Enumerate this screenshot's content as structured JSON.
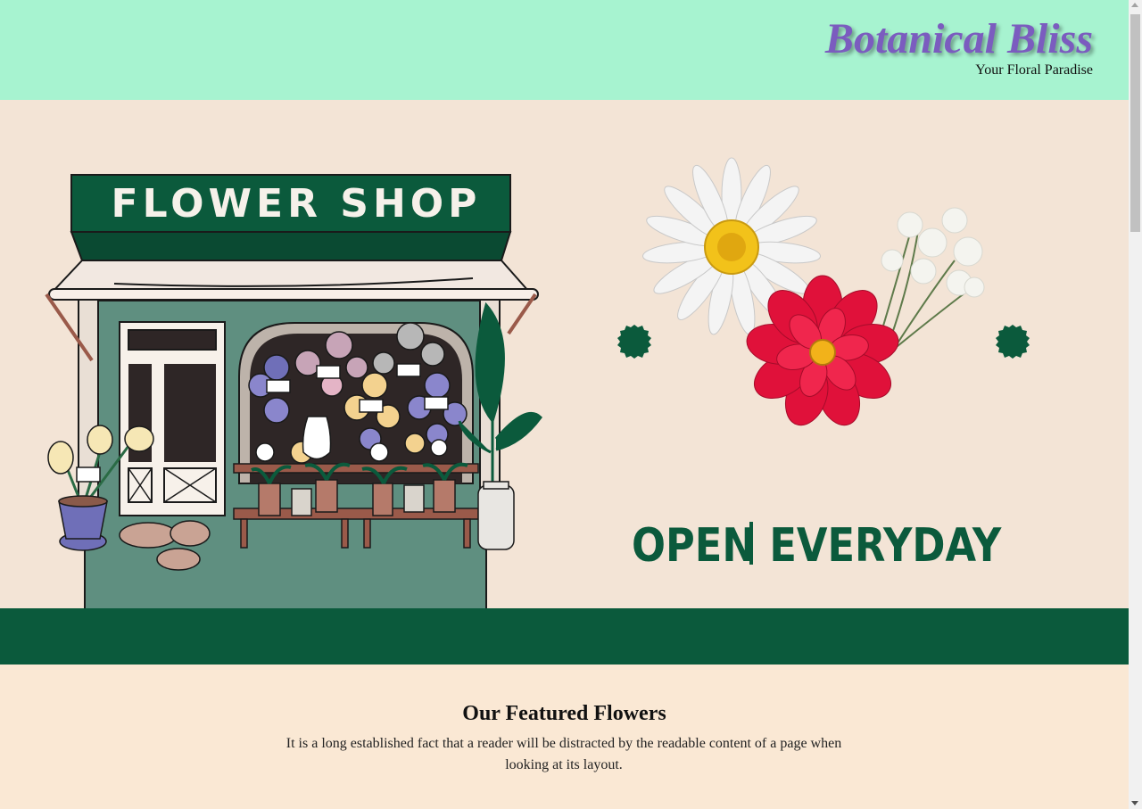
{
  "header": {
    "brand": "Botanical Bliss",
    "tagline": "Your Floral Paradise"
  },
  "hero": {
    "shop_sign": "FLOWER SHOP",
    "open_text": "OPEN EVERYDAY"
  },
  "featured": {
    "title": "Our Featured Flowers",
    "text": "It is a long established fact that a reader will be distracted by the readable content of a page when looking at its layout."
  },
  "colors": {
    "header_bg": "#a7f3d0",
    "brand": "#7b5cbf",
    "hero_bg": "#f3e4d6",
    "accent_green": "#0b5a3c",
    "featured_bg": "#fae8d4",
    "flower_red": "#e0113a"
  }
}
